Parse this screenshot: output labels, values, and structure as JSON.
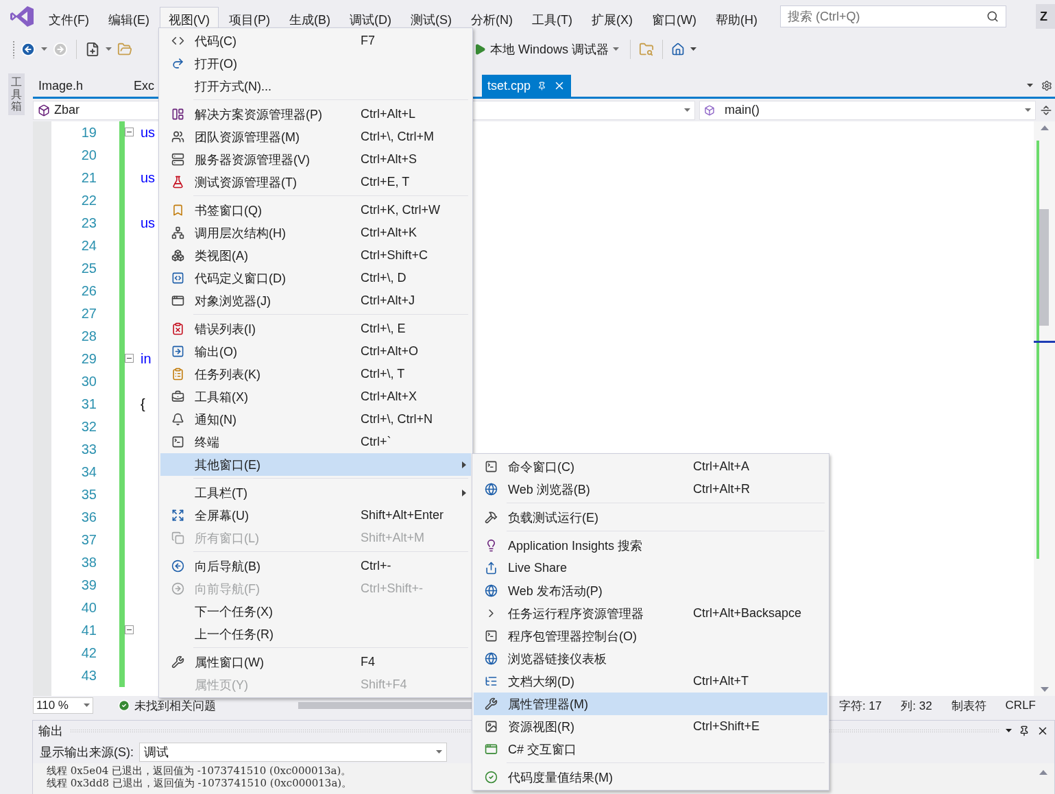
{
  "menu_bar": [
    {
      "label": "文件(F)",
      "selected": false
    },
    {
      "label": "编辑(E)",
      "selected": false
    },
    {
      "label": "视图(V)",
      "selected": true
    },
    {
      "label": "项目(P)",
      "selected": false
    },
    {
      "label": "生成(B)",
      "selected": false
    },
    {
      "label": "调试(D)",
      "selected": false
    },
    {
      "label": "测试(S)",
      "selected": false
    },
    {
      "label": "分析(N)",
      "selected": false
    },
    {
      "label": "工具(T)",
      "selected": false
    },
    {
      "label": "扩展(X)",
      "selected": false
    },
    {
      "label": "窗口(W)",
      "selected": false
    },
    {
      "label": "帮助(H)",
      "selected": false
    }
  ],
  "search": {
    "placeholder": "搜索 (Ctrl+Q)"
  },
  "account_initial": "Z",
  "toolbar": {
    "debugger": "本地 Windows 调试器"
  },
  "toolbox_tab": "工具箱",
  "tabs": [
    {
      "label": "Image.h",
      "selected": false
    },
    {
      "label": "Exc",
      "selected": false
    },
    {
      "label": "tset.cpp",
      "selected": true
    }
  ],
  "nav_bar": {
    "project": "Zbar",
    "function": "main()"
  },
  "editor": {
    "lines": [
      {
        "number": "19",
        "code": "us",
        "kind": "keyword",
        "fold": true
      },
      {
        "number": "20",
        "fold": false
      },
      {
        "number": "21",
        "code": "us",
        "kind": "keyword",
        "fold": false
      },
      {
        "number": "22",
        "fold": false
      },
      {
        "number": "23",
        "code": "us",
        "kind": "keyword",
        "fold": false
      },
      {
        "number": "24",
        "fold": false
      },
      {
        "number": "25",
        "fold": false
      },
      {
        "number": "26",
        "fold": false
      },
      {
        "number": "27",
        "fold": false
      },
      {
        "number": "28",
        "fold": false
      },
      {
        "number": "29",
        "code": "in",
        "kind": "keyword",
        "fold": true
      },
      {
        "number": "30",
        "fold": false
      },
      {
        "number": "31",
        "code": "{",
        "kind": "plain",
        "fold": false
      },
      {
        "number": "32",
        "fold": false
      },
      {
        "number": "33",
        "fold": false
      },
      {
        "number": "34",
        "fold": false
      },
      {
        "number": "35",
        "fold": false
      },
      {
        "number": "36",
        "fold": false
      },
      {
        "number": "37",
        "fold": false
      },
      {
        "number": "38",
        "fold": false
      },
      {
        "number": "39",
        "fold": false
      },
      {
        "number": "40",
        "fold": false
      },
      {
        "number": "41",
        "fold": true
      },
      {
        "number": "42",
        "fold": false
      },
      {
        "number": "43",
        "fold": false
      }
    ]
  },
  "status": {
    "zoom": "110 %",
    "issues": "未找到相关问题",
    "char": "字符: 17",
    "column": "列: 32",
    "indent": "制表符",
    "line_ending": "CRLF"
  },
  "output": {
    "title": "输出",
    "source_label": "显示输出来源(S):",
    "source": "调试",
    "lines": [
      "线程 0x5e04 已退出，返回值为 -1073741510 (0xc000013a)。",
      "线程 0x3dd8 已退出，返回值为 -1073741510 (0xc000013a)。"
    ]
  },
  "view_menu": {
    "groups": [
      [
        {
          "label": "代码(C)",
          "shortcut": "F7",
          "disabled": false,
          "selected": false,
          "submenu": false
        },
        {
          "label": "打开(O)",
          "disabled": false,
          "selected": false,
          "submenu": false
        },
        {
          "label": "打开方式(N)...",
          "disabled": false,
          "selected": false,
          "submenu": false
        }
      ],
      [
        {
          "label": "解决方案资源管理器(P)",
          "shortcut": "Ctrl+Alt+L",
          "disabled": false,
          "selected": false,
          "submenu": false
        },
        {
          "label": "团队资源管理器(M)",
          "shortcut": "Ctrl+\\, Ctrl+M",
          "disabled": false,
          "selected": false,
          "submenu": false
        },
        {
          "label": "服务器资源管理器(V)",
          "shortcut": "Ctrl+Alt+S",
          "disabled": false,
          "selected": false,
          "submenu": false
        },
        {
          "label": "测试资源管理器(T)",
          "shortcut": "Ctrl+E, T",
          "disabled": false,
          "selected": false,
          "submenu": false
        }
      ],
      [
        {
          "label": "书签窗口(Q)",
          "shortcut": "Ctrl+K, Ctrl+W",
          "disabled": false,
          "selected": false,
          "submenu": false
        },
        {
          "label": "调用层次结构(H)",
          "shortcut": "Ctrl+Alt+K",
          "disabled": false,
          "selected": false,
          "submenu": false
        },
        {
          "label": "类视图(A)",
          "shortcut": "Ctrl+Shift+C",
          "disabled": false,
          "selected": false,
          "submenu": false
        },
        {
          "label": "代码定义窗口(D)",
          "shortcut": "Ctrl+\\, D",
          "disabled": false,
          "selected": false,
          "submenu": false
        },
        {
          "label": "对象浏览器(J)",
          "shortcut": "Ctrl+Alt+J",
          "disabled": false,
          "selected": false,
          "submenu": false
        }
      ],
      [
        {
          "label": "错误列表(I)",
          "shortcut": "Ctrl+\\, E",
          "disabled": false,
          "selected": false,
          "submenu": false
        },
        {
          "label": "输出(O)",
          "shortcut": "Ctrl+Alt+O",
          "disabled": false,
          "selected": false,
          "submenu": false
        },
        {
          "label": "任务列表(K)",
          "shortcut": "Ctrl+\\, T",
          "disabled": false,
          "selected": false,
          "submenu": false
        },
        {
          "label": "工具箱(X)",
          "shortcut": "Ctrl+Alt+X",
          "disabled": false,
          "selected": false,
          "submenu": false
        },
        {
          "label": "通知(N)",
          "shortcut": "Ctrl+\\, Ctrl+N",
          "disabled": false,
          "selected": false,
          "submenu": false
        },
        {
          "label": "终端",
          "shortcut": "Ctrl+`",
          "disabled": false,
          "selected": false,
          "submenu": false
        },
        {
          "label": "其他窗口(E)",
          "disabled": false,
          "selected": true,
          "submenu": true
        }
      ],
      [
        {
          "label": "工具栏(T)",
          "disabled": false,
          "selected": false,
          "submenu": true
        },
        {
          "label": "全屏幕(U)",
          "shortcut": "Shift+Alt+Enter",
          "disabled": false,
          "selected": false,
          "submenu": false
        },
        {
          "label": "所有窗口(L)",
          "shortcut": "Shift+Alt+M",
          "disabled": true,
          "selected": false,
          "submenu": false
        }
      ],
      [
        {
          "label": "向后导航(B)",
          "shortcut": "Ctrl+-",
          "disabled": false,
          "selected": false,
          "submenu": false
        },
        {
          "label": "向前导航(F)",
          "shortcut": "Ctrl+Shift+-",
          "disabled": true,
          "selected": false,
          "submenu": false
        },
        {
          "label": "下一个任务(X)",
          "disabled": false,
          "selected": false,
          "submenu": false
        },
        {
          "label": "上一个任务(R)",
          "disabled": false,
          "selected": false,
          "submenu": false
        }
      ],
      [
        {
          "label": "属性窗口(W)",
          "shortcut": "F4",
          "disabled": false,
          "selected": false,
          "submenu": false
        },
        {
          "label": "属性页(Y)",
          "shortcut": "Shift+F4",
          "disabled": true,
          "selected": false,
          "submenu": false
        }
      ]
    ]
  },
  "other_windows_menu": {
    "groups": [
      [
        {
          "label": "命令窗口(C)",
          "shortcut": "Ctrl+Alt+A",
          "disabled": false,
          "selected": false,
          "submenu": false
        },
        {
          "label": "Web 浏览器(B)",
          "shortcut": "Ctrl+Alt+R",
          "disabled": false,
          "selected": false,
          "submenu": false
        }
      ],
      [
        {
          "label": "负载测试运行(E)",
          "disabled": false,
          "selected": false,
          "submenu": false
        }
      ],
      [
        {
          "label": "Application Insights 搜索",
          "disabled": false,
          "selected": false,
          "submenu": false
        },
        {
          "label": "Live Share",
          "disabled": false,
          "selected": false,
          "submenu": false
        },
        {
          "label": "Web 发布活动(P)",
          "disabled": false,
          "selected": false,
          "submenu": false
        },
        {
          "label": "任务运行程序资源管理器",
          "shortcut": "Ctrl+Alt+Backsapce",
          "disabled": false,
          "selected": false,
          "submenu": false
        },
        {
          "label": "程序包管理器控制台(O)",
          "disabled": false,
          "selected": false,
          "submenu": false
        },
        {
          "label": "浏览器链接仪表板",
          "disabled": false,
          "selected": false,
          "submenu": false
        },
        {
          "label": "文档大纲(D)",
          "shortcut": "Ctrl+Alt+T",
          "disabled": false,
          "selected": false,
          "submenu": false
        },
        {
          "label": "属性管理器(M)",
          "disabled": false,
          "selected": true,
          "submenu": false
        },
        {
          "label": "资源视图(R)",
          "shortcut": "Ctrl+Shift+E",
          "disabled": false,
          "selected": false,
          "submenu": false
        },
        {
          "label": "C# 交互窗口",
          "disabled": false,
          "selected": false,
          "submenu": false
        }
      ],
      [
        {
          "label": "代码度量值结果(M)",
          "disabled": false,
          "selected": false,
          "submenu": false
        }
      ]
    ]
  }
}
